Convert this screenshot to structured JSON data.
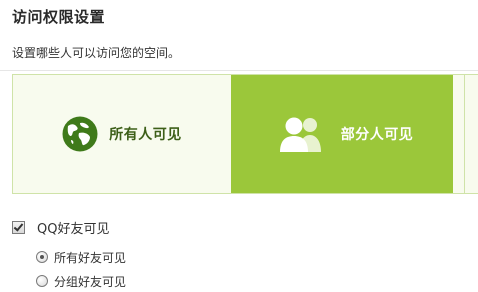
{
  "section": {
    "title": "访问权限设置",
    "subtitle": "设置哪些人可以访问您的空间。"
  },
  "visibility_options": [
    {
      "label": "所有人可见",
      "icon": "globe-icon",
      "selected": false
    },
    {
      "label": "部分人可见",
      "icon": "people-icon",
      "selected": true
    }
  ],
  "qq_friends": {
    "label": "QQ好友可见",
    "checked": true,
    "options": [
      {
        "label": "所有好友可见",
        "selected": true
      },
      {
        "label": "分组好友可见",
        "selected": false
      }
    ]
  },
  "colors": {
    "accent_green": "#9bc73a",
    "panel_bg": "#f8fbee",
    "globe_green": "#3f7a1a"
  }
}
